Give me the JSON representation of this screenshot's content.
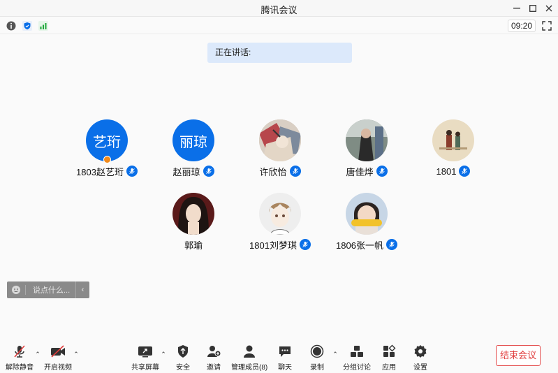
{
  "window": {
    "title": "腾讯会议"
  },
  "infobar": {
    "clock": "09:20"
  },
  "speaking": {
    "label": "正在讲话:"
  },
  "participants": [
    {
      "name": "1803赵艺珩",
      "avatar_text": "艺珩",
      "host": true
    },
    {
      "name": "赵丽琼",
      "avatar_text": "丽琼"
    },
    {
      "name": "许欣怡"
    },
    {
      "name": "唐佳烨"
    },
    {
      "name": "1801"
    },
    {
      "name": "郭瑜"
    },
    {
      "name": "1801刘梦琪"
    },
    {
      "name": "1806张一帆"
    }
  ],
  "chat": {
    "placeholder": "说点什么..."
  },
  "toolbar": {
    "unmute": "解除静音",
    "start_video": "开启视频",
    "share_screen": "共享屏幕",
    "security": "安全",
    "invite": "邀请",
    "manage_members": "管理成员(8)",
    "chat": "聊天",
    "record": "录制",
    "breakout": "分组讨论",
    "apps": "应用",
    "settings": "设置",
    "end_meeting": "结束会议"
  },
  "colors": {
    "accent": "#0a6fe8",
    "end": "#e03c3c",
    "speaking_bg": "#dce9fb"
  }
}
